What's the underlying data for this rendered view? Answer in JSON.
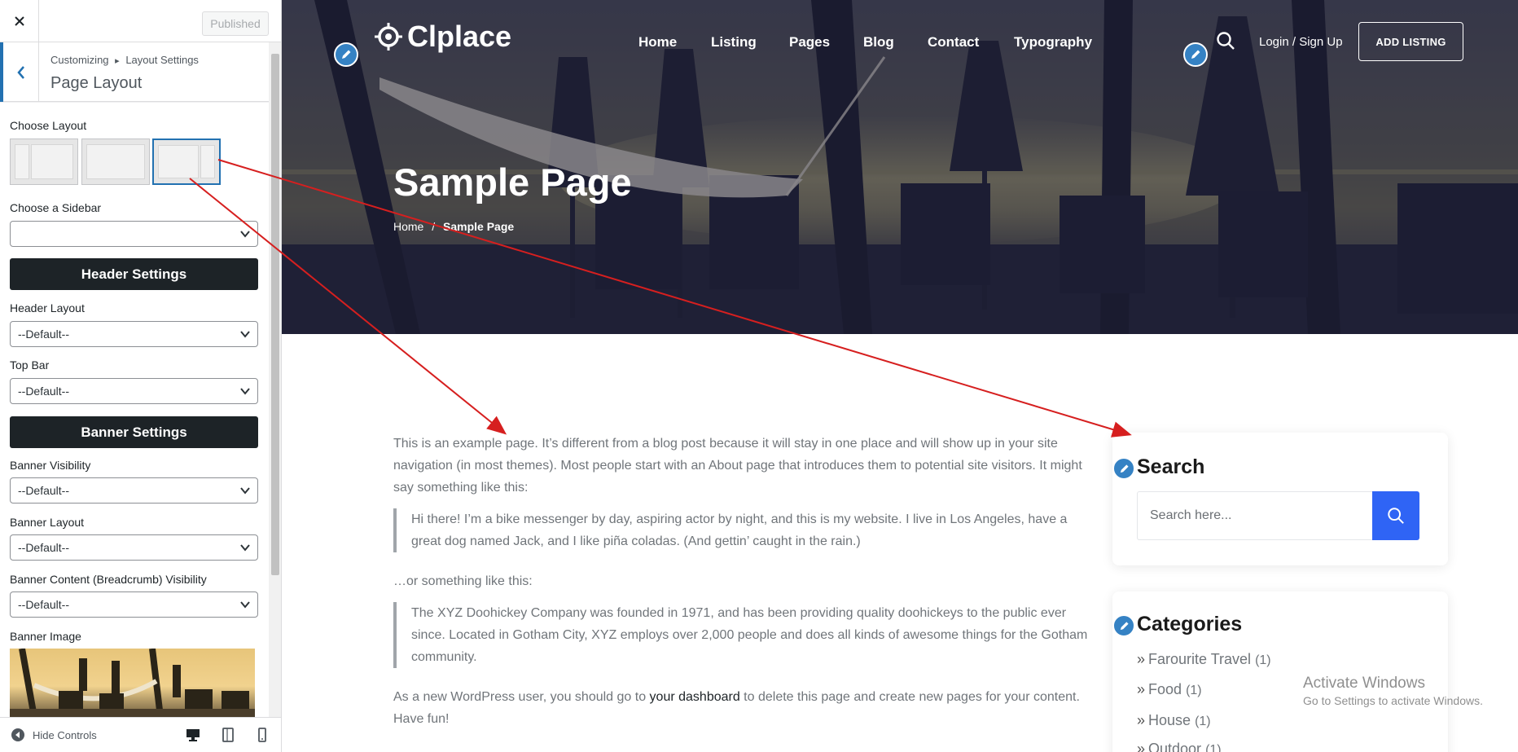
{
  "customizer": {
    "close_label": "×",
    "publish_label": "Published",
    "breadcrumb_root": "Customizing",
    "breadcrumb_sep": "▸",
    "breadcrumb_section": "Layout Settings",
    "panel_title": "Page Layout",
    "choose_layout_label": "Choose Layout",
    "layout_options": [
      "left-sidebar",
      "full-width",
      "right-sidebar"
    ],
    "selected_layout": "right-sidebar",
    "choose_sidebar_label": "Choose a Sidebar",
    "choose_sidebar_value": "",
    "header_settings_label": "Header Settings",
    "header_layout_label": "Header Layout",
    "header_layout_value": "--Default--",
    "top_bar_label": "Top Bar",
    "top_bar_value": "--Default--",
    "banner_settings_label": "Banner Settings",
    "banner_visibility_label": "Banner Visibility",
    "banner_visibility_value": "--Default--",
    "banner_layout_label": "Banner Layout",
    "banner_layout_value": "--Default--",
    "banner_content_label": "Banner Content (Breadcrumb) Visibility",
    "banner_content_value": "--Default--",
    "banner_image_label": "Banner Image",
    "hide_controls_label": "Hide Controls",
    "devices": [
      "desktop-icon",
      "tablet-icon",
      "mobile-icon"
    ]
  },
  "site": {
    "logo_text": "Clplace",
    "nav": [
      "Home",
      "Listing",
      "Pages",
      "Blog",
      "Contact",
      "Typography"
    ],
    "login_label": "Login / Sign Up",
    "add_listing_label": "ADD LISTING",
    "page_title": "Sample Page",
    "breadcrumb_home": "Home",
    "breadcrumb_sep": "/",
    "breadcrumb_current": "Sample Page",
    "content": {
      "p1": "This is an example page. It’s different from a blog post because it will stay in one place and will show up in your site navigation (in most themes). Most people start with an About page that introduces them to potential site visitors. It might say something like this:",
      "q1": "Hi there! I’m a bike messenger by day, aspiring actor by night, and this is my website. I live in Los Angeles, have a great dog named Jack, and I like piña coladas. (And gettin’ caught in the rain.)",
      "p2": "…or something like this:",
      "q2": "The XYZ Doohickey Company was founded in 1971, and has been providing quality doohickeys to the public ever since. Located in Gotham City, XYZ employs over 2,000 people and does all kinds of awesome things for the Gotham community.",
      "p3_before": "As a new WordPress user, you should go to ",
      "p3_link": "your dashboard",
      "p3_after": " to delete this page and create new pages for your content. Have fun!"
    },
    "search_widget": {
      "title": "Search",
      "placeholder": "Search here..."
    },
    "categories_widget": {
      "title": "Categories",
      "items": [
        {
          "label": "Farourite Travel",
          "count": "(1)"
        },
        {
          "label": "Food",
          "count": "(1)"
        },
        {
          "label": "House",
          "count": "(1)"
        },
        {
          "label": "Outdoor",
          "count": "(1)"
        }
      ]
    }
  },
  "watermark": {
    "line1": "Activate Windows",
    "line2": "Go to Settings to activate Windows."
  },
  "colors": {
    "wp_blue": "#2271b1",
    "dark_button": "#1d2327",
    "search_button": "#2f64f5",
    "pencil_blue": "#3582c4",
    "annotation_arrow": "#d61f1f"
  }
}
